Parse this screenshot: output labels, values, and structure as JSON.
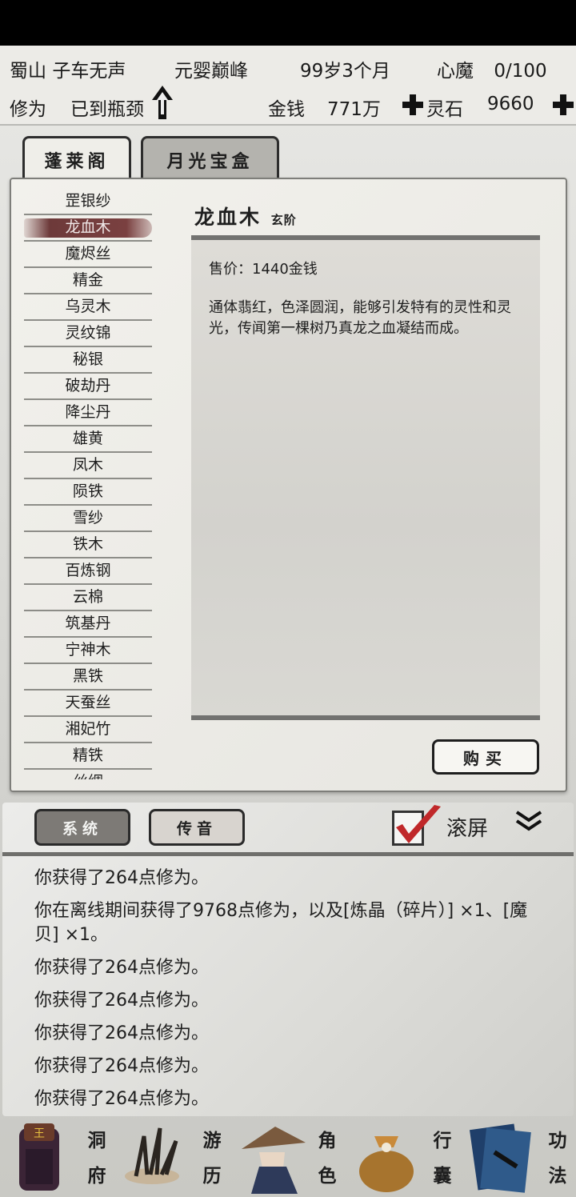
{
  "header": {
    "location": "蜀山",
    "name": "子车无声",
    "realm": "元婴巅峰",
    "age": "99岁3个月",
    "demon_label": "心魔",
    "demon_value": "0/100",
    "cultivation_label": "修为",
    "cultivation_value": "已到瓶颈",
    "money_label": "金钱",
    "money_value": "771万",
    "stone_label": "灵石",
    "stone_value": "9660"
  },
  "shop_tabs": [
    "蓬莱阁",
    "月光宝盒"
  ],
  "items": [
    "罡银纱",
    "龙血木",
    "魔烬丝",
    "精金",
    "乌灵木",
    "灵纹锦",
    "秘银",
    "破劫丹",
    "降尘丹",
    "雄黄",
    "凤木",
    "陨铁",
    "雪纱",
    "铁木",
    "百炼钢",
    "云棉",
    "筑基丹",
    "宁神木",
    "黑铁",
    "天蚕丝",
    "湘妃竹",
    "精铁",
    "丝绸"
  ],
  "selected_index": 1,
  "detail": {
    "name": "龙血木",
    "grade": "玄阶",
    "price": "售价：1440金钱",
    "description": "通体翡红，色泽圆润，能够引发特有的灵性和灵光，传闻第一棵树乃真龙之血凝结而成。"
  },
  "buy_label": "购买",
  "log_tabs": [
    "系统",
    "传音"
  ],
  "scroll_label": "滚屏",
  "messages": [
    "你获得了264点修为。",
    "你在离线期间获得了9768点修为，以及[炼晶（碎片）] ×1、[魔贝] ×1。",
    "你获得了264点修为。",
    "你获得了264点修为。",
    "你获得了264点修为。",
    "你获得了264点修为。",
    "你获得了264点修为。"
  ],
  "nav": [
    {
      "label": "洞府",
      "icon": "cave-residence-icon"
    },
    {
      "label": "游历",
      "icon": "travel-icon"
    },
    {
      "label": "角色",
      "icon": "character-icon"
    },
    {
      "label": "行囊",
      "icon": "inventory-bag-icon"
    },
    {
      "label": "功法",
      "icon": "skill-book-icon"
    }
  ],
  "colors": {
    "accent_dark": "#2d2d2d",
    "selected_item": "#6d3a3a",
    "check_red": "#c0282a"
  }
}
